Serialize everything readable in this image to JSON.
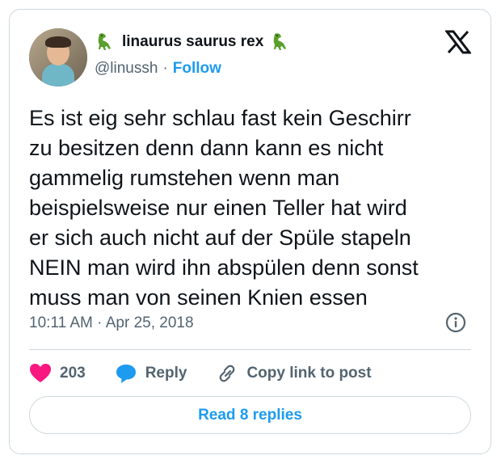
{
  "user": {
    "display_name": "linaurus saurus rex",
    "handle": "@linussh",
    "separator": "·",
    "follow_label": "Follow",
    "name_emoji": "t-rex-icon"
  },
  "tweet": {
    "text": "Es ist eig sehr schlau fast kein Geschirr\nzu besitzen denn dann kann es nicht\ngammelig rumstehen wenn man\nbeispielsweise nur einen Teller hat wird\ner sich auch nicht auf der Spüle stapeln\nNEIN man wird ihn abspülen denn sonst\nmuss man von seinen Knien essen",
    "time": "10:11 AM",
    "date": "Apr 25, 2018",
    "separator": "·"
  },
  "actions": {
    "like_count": "203",
    "reply_label": "Reply",
    "copy_link_label": "Copy link to post"
  },
  "read_replies_label": "Read 8 replies",
  "colors": {
    "accent": "#1d9bf0",
    "like": "#f91880",
    "muted": "#536471",
    "border": "#cfd9de"
  }
}
